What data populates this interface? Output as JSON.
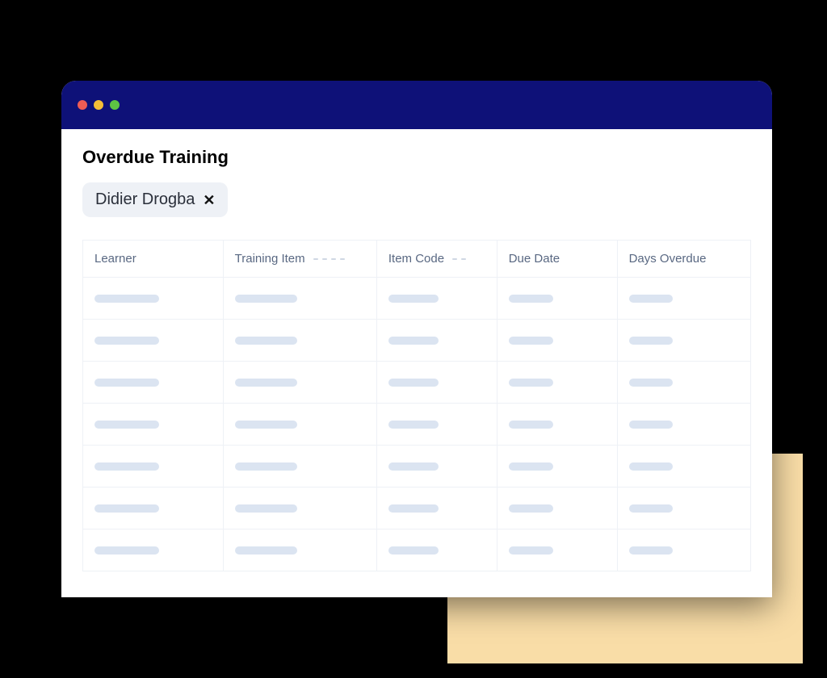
{
  "colors": {
    "titlebar": "#0e1178",
    "accent_block": "#f9dda7",
    "chip_bg": "#eef1f6",
    "skeleton": "#dbe4f1",
    "header_text": "#596882"
  },
  "window": {
    "title": "Overdue Training"
  },
  "filter": {
    "label": "Didier Drogba"
  },
  "table": {
    "columns": [
      {
        "label": "Learner"
      },
      {
        "label": "Training Item"
      },
      {
        "label": "Item Code"
      },
      {
        "label": "Due Date"
      },
      {
        "label": "Days Overdue"
      }
    ],
    "row_count": 7
  }
}
